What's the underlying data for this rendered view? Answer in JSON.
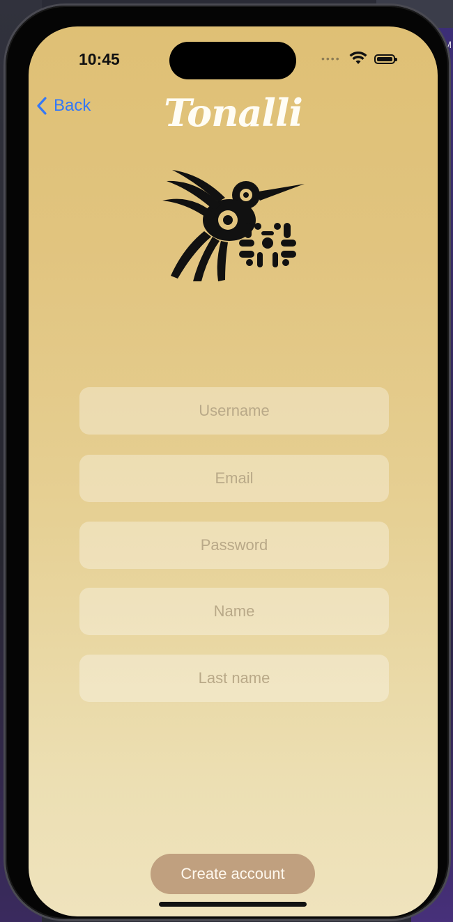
{
  "status_bar": {
    "time": "10:45"
  },
  "nav": {
    "back_label": "Back"
  },
  "app": {
    "title": "Tonalli"
  },
  "form": {
    "username_placeholder": "Username",
    "email_placeholder": "Email",
    "password_placeholder": "Password",
    "name_placeholder": "Name",
    "last_name_placeholder": "Last name"
  },
  "actions": {
    "create_account_label": "Create account"
  },
  "background": {
    "corner_text": "PM"
  },
  "icons": {
    "back": "chevron-left-icon",
    "wifi": "wifi-icon",
    "battery": "battery-icon",
    "logo": "hummingbird-logo"
  },
  "colors": {
    "accent": "#3478f6",
    "button": "#c0a07f",
    "background_top": "#dfc075",
    "background_bottom": "#efe3bd"
  }
}
